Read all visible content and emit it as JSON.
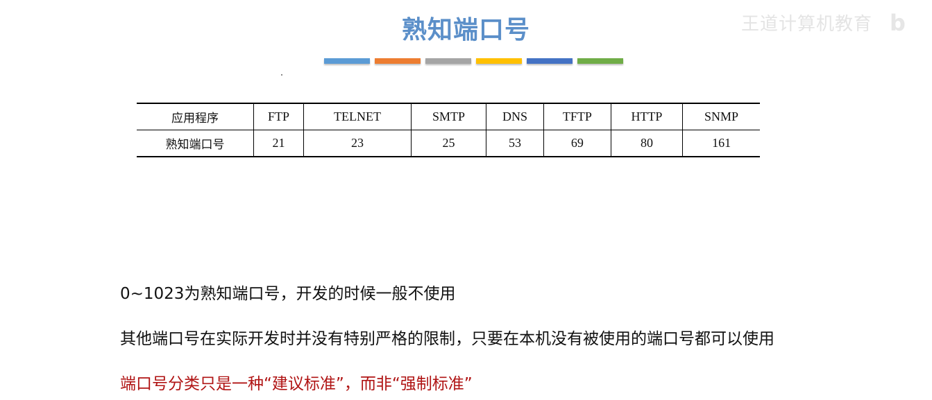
{
  "slide": {
    "title": "熟知端口号",
    "watermark": "王道计算机教育",
    "watermark_logo": "b站",
    "color_bars": [
      "#5b9bd5",
      "#ed7d31",
      "#a5a5a5",
      "#ffc000",
      "#4472c4",
      "#70ad47"
    ]
  },
  "table": {
    "header": [
      "应用程序",
      "FTP",
      "TELNET",
      "SMTP",
      "DNS",
      "TFTP",
      "HTTP",
      "SNMP"
    ],
    "row": [
      "熟知端口号",
      "21",
      "23",
      "25",
      "53",
      "69",
      "80",
      "161"
    ]
  },
  "notes": {
    "line1": "0~1023为熟知端口号，开发的时候一般不使用",
    "line2": "其他端口号在实际开发时并没有特别严格的限制，只要在本机没有被使用的端口号都可以使用",
    "line3": "端口号分类只是一种“建议标准”，而非“强制标准”",
    "line3_color": "#b01414"
  }
}
